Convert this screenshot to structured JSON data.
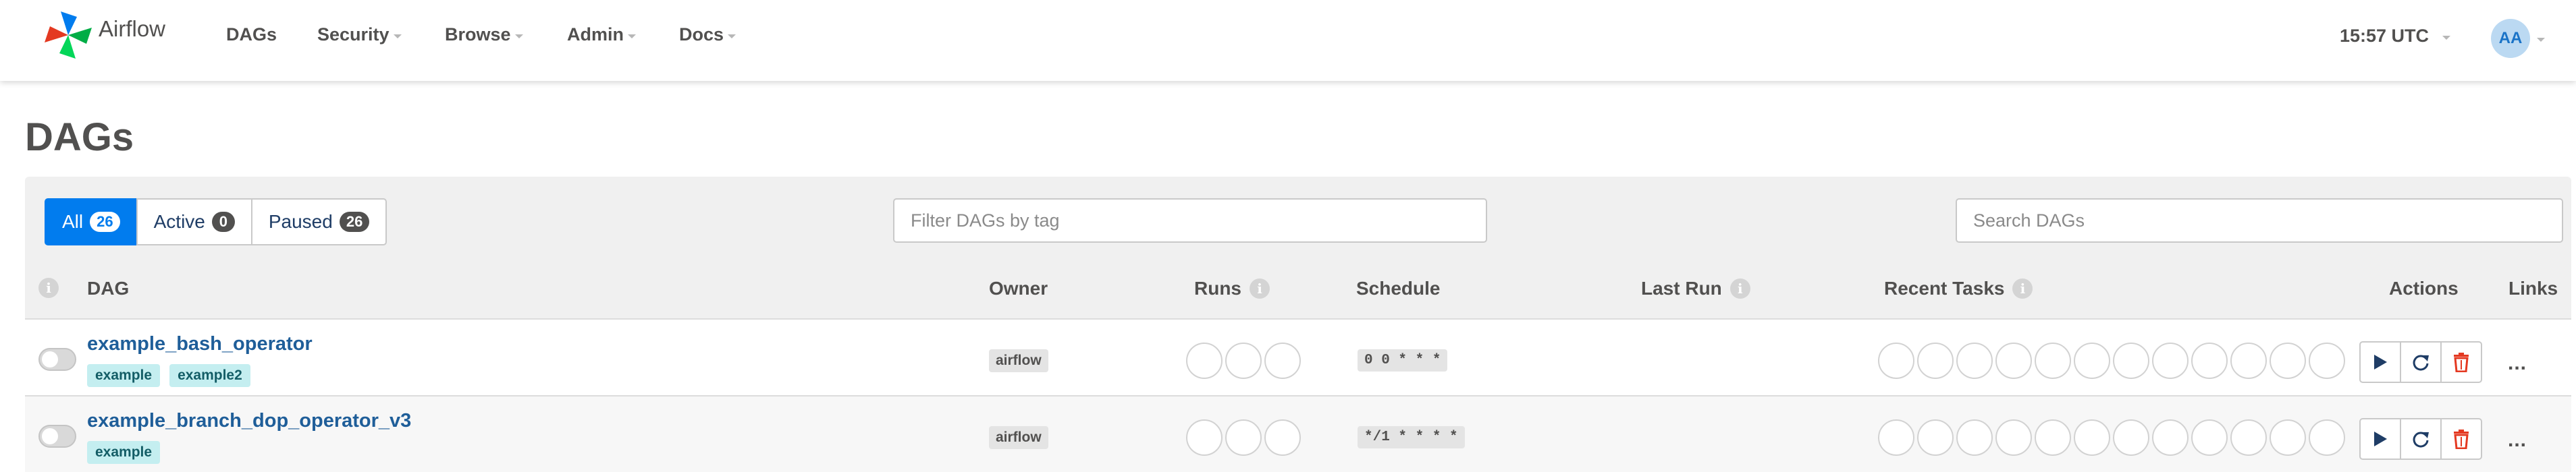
{
  "app": {
    "name": "Airflow"
  },
  "nav": {
    "items": [
      "DAGs",
      "Security",
      "Browse",
      "Admin",
      "Docs"
    ],
    "time": "15:57 UTC",
    "user_initials": "AA"
  },
  "page": {
    "title": "DAGs"
  },
  "filters": {
    "all_label": "All",
    "all_count": "26",
    "active_label": "Active",
    "active_count": "0",
    "paused_label": "Paused",
    "paused_count": "26",
    "tag_placeholder": "Filter DAGs by tag",
    "search_placeholder": "Search DAGs"
  },
  "table": {
    "headers": {
      "dag": "DAG",
      "owner": "Owner",
      "runs": "Runs",
      "schedule": "Schedule",
      "last_run": "Last Run",
      "recent_tasks": "Recent Tasks",
      "actions": "Actions",
      "links": "Links"
    },
    "rows": [
      {
        "dag_id": "example_bash_operator",
        "tags": [
          "example",
          "example2"
        ],
        "owner": "airflow",
        "schedule": "0 0 * * *",
        "last_run": ""
      },
      {
        "dag_id": "example_branch_dop_operator_v3",
        "tags": [
          "example"
        ],
        "owner": "airflow",
        "schedule": "*/1 * * * *",
        "last_run": ""
      }
    ],
    "more_label": "..."
  },
  "colors": {
    "primary": "#017cee",
    "link": "#1f5e99",
    "tag_bg": "#c4eef0",
    "delete": "#e43921",
    "panel_bg": "#f0f0f0"
  },
  "icons": {
    "info": "info-icon",
    "trigger": "play-icon",
    "refresh": "refresh-icon",
    "delete": "trash-icon"
  }
}
